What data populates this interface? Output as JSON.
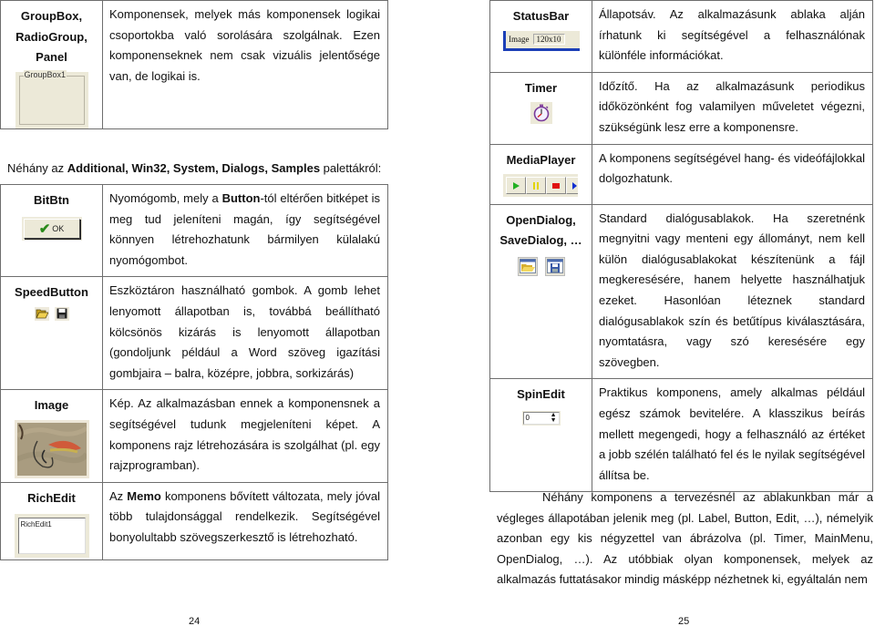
{
  "left_page": {
    "top_table": {
      "rows": [
        {
          "name_lines": [
            "GroupBox,",
            "RadioGroup,",
            "Panel"
          ],
          "preview": {
            "type": "groupbox",
            "label": "GroupBox1"
          },
          "description": "Komponensek, melyek más komponensek logikai csoportokba való sorolására szolgálnak. Ezen komponenseknek nem csak vizuális jelentősége van, de logikai is."
        }
      ]
    },
    "heading": {
      "prefix": "Néhány az ",
      "bold": "Additional, Win32, System, Dialogs, Samples",
      "suffix": " palettákról:"
    },
    "table": {
      "rows": [
        {
          "name": "BitBtn",
          "preview": {
            "type": "bitbtn",
            "label": "OK",
            "icon": "checkmark-icon"
          },
          "desc_prefix": "Nyomógomb, mely a ",
          "desc_bold": "Button",
          "desc_suffix": "-tól eltérően bitképet is meg tud jeleníteni magán, így segítségével könnyen létrehozhatunk bármilyen külalakú nyomógombot."
        },
        {
          "name": "SpeedButton",
          "preview": {
            "type": "speedbuttons",
            "icons": [
              "open-folder-icon",
              "save-disk-icon"
            ]
          },
          "description": "Eszköztáron használható gombok. A gomb lehet lenyomott állapotban is, továbbá beállítható kölcsönös kizárás is lenyomott állapotban (gondoljunk például a Word szöveg igazítási gombjaira – balra, középre, jobbra, sorkizárás)"
        },
        {
          "name": "Image",
          "preview": {
            "type": "image",
            "icon": "fishing-fly-image"
          },
          "description": "Kép. Az alkalmazásban ennek a komponensnek a segítségével tudunk megjeleníteni képet. A komponens rajz létrehozására is szolgálhat (pl. egy rajzprogramban)."
        },
        {
          "name": "RichEdit",
          "preview": {
            "type": "richedit",
            "label": "RichEdit1"
          },
          "desc_prefix": "Az ",
          "desc_bold": "Memo",
          "desc_suffix": " komponens bővített változata, mely jóval több tulajdonsággal rendelkezik. Segítségével bonyolultabb szövegszerkesztő is létrehozható."
        }
      ]
    },
    "page_number": "24"
  },
  "right_page": {
    "table": {
      "rows": [
        {
          "name": "StatusBar",
          "preview": {
            "type": "statusbar",
            "panels": [
              "Image",
              "120x10"
            ]
          },
          "description": "Állapotsáv. Az alkalmazásunk ablaka alján írhatunk ki segítségével a felhasználónak különféle információkat."
        },
        {
          "name": "Timer",
          "preview": {
            "type": "timer",
            "icon": "stopwatch-icon"
          },
          "description": "Időzítő. Ha az alkalmazásunk periodikus időközönként fog valamilyen műveletet végezni, szükségünk lesz erre a komponensre."
        },
        {
          "name": "MediaPlayer",
          "preview": {
            "type": "mediaplayer",
            "buttons": [
              "play-icon",
              "pause-icon",
              "stop-icon",
              "next-icon"
            ]
          },
          "description": "A komponens segítségével hang- és videófájlokkal dolgozhatunk."
        },
        {
          "name_lines": [
            "OpenDialog,",
            "SaveDialog, …"
          ],
          "preview": {
            "type": "dialogs",
            "icons": [
              "open-dialog-icon",
              "save-dialog-icon"
            ]
          },
          "description": "Standard dialógusablakok. Ha szeretnénk megnyitni vagy menteni egy állományt, nem kell külön dialógusablakokat készítenünk a fájl megkeresésére, hanem helyette használhatjuk ezeket. Hasonlóan léteznek standard dialógusablakok szín és betűtípus kiválasztására, nyomtatásra, vagy szó keresésére egy szövegben."
        },
        {
          "name": "SpinEdit",
          "preview": {
            "type": "spinedit",
            "value": "0"
          },
          "description": "Praktikus komponens, amely alkalmas például egész számok bevitelére. A klasszikus beírás mellett megengedi, hogy a felhasználó az értéket a jobb szélén található fel és le nyilak segítségével állítsa be."
        }
      ]
    },
    "paragraph": "Néhány komponens a tervezésnél az ablakunkban már a végleges állapotában jelenik meg (pl. Label, Button, Edit, …), némelyik azonban egy kis négyzettel van ábrázolva (pl. Timer, MainMenu, OpenDialog, …). Az utóbbiak olyan komponensek, melyek az alkalmazás futtatásakor mindig másképp nézhetnek ki, egyáltalán nem",
    "page_number": "25"
  },
  "colors": {
    "border": "#6e6e6e",
    "control_face": "#ece9d8",
    "statusbar_accent": "#1c3fb7",
    "play_green": "#22b022",
    "pause_yellow": "#e2d400",
    "stop_red": "#e01010",
    "next_blue": "#1030d0"
  }
}
